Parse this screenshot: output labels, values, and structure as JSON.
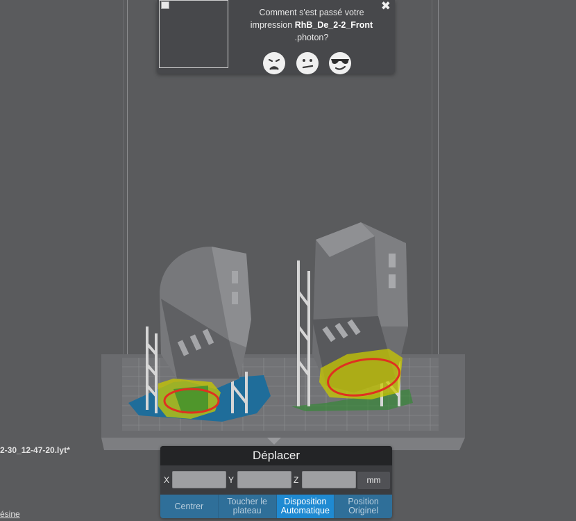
{
  "feedback": {
    "line1": "Comment s'est passé votre",
    "prefix": "impression",
    "filename": "RhB_De_2-2_Front",
    "extension": ".photon?",
    "close_glyph": "✖",
    "faces": [
      "sad-face-icon",
      "neutral-face-icon",
      "cool-face-icon"
    ]
  },
  "file_label": "2-30_12-47-20.lyt*",
  "resin_link": "ésine",
  "move_panel": {
    "title": "Déplacer",
    "axes": [
      {
        "label": "X",
        "value": ""
      },
      {
        "label": "Y",
        "value": ""
      },
      {
        "label": "Z",
        "value": ""
      }
    ],
    "unit": "mm",
    "actions": [
      {
        "label": "Centrer",
        "active": false
      },
      {
        "label": "Toucher le plateau",
        "active": false
      },
      {
        "label": "Disposition Automatique",
        "active": true
      },
      {
        "label": "Position Originel",
        "active": false
      }
    ]
  },
  "colors": {
    "background": "#5a5b5d",
    "panel": "#3b3c3f",
    "accent": "#1f8ad2",
    "button": "#2f6f99",
    "highlight_yellow": "#c8c800",
    "highlight_red": "#e03020",
    "resin_blue": "#1f6d9a",
    "support_green": "#2d8a2d"
  }
}
